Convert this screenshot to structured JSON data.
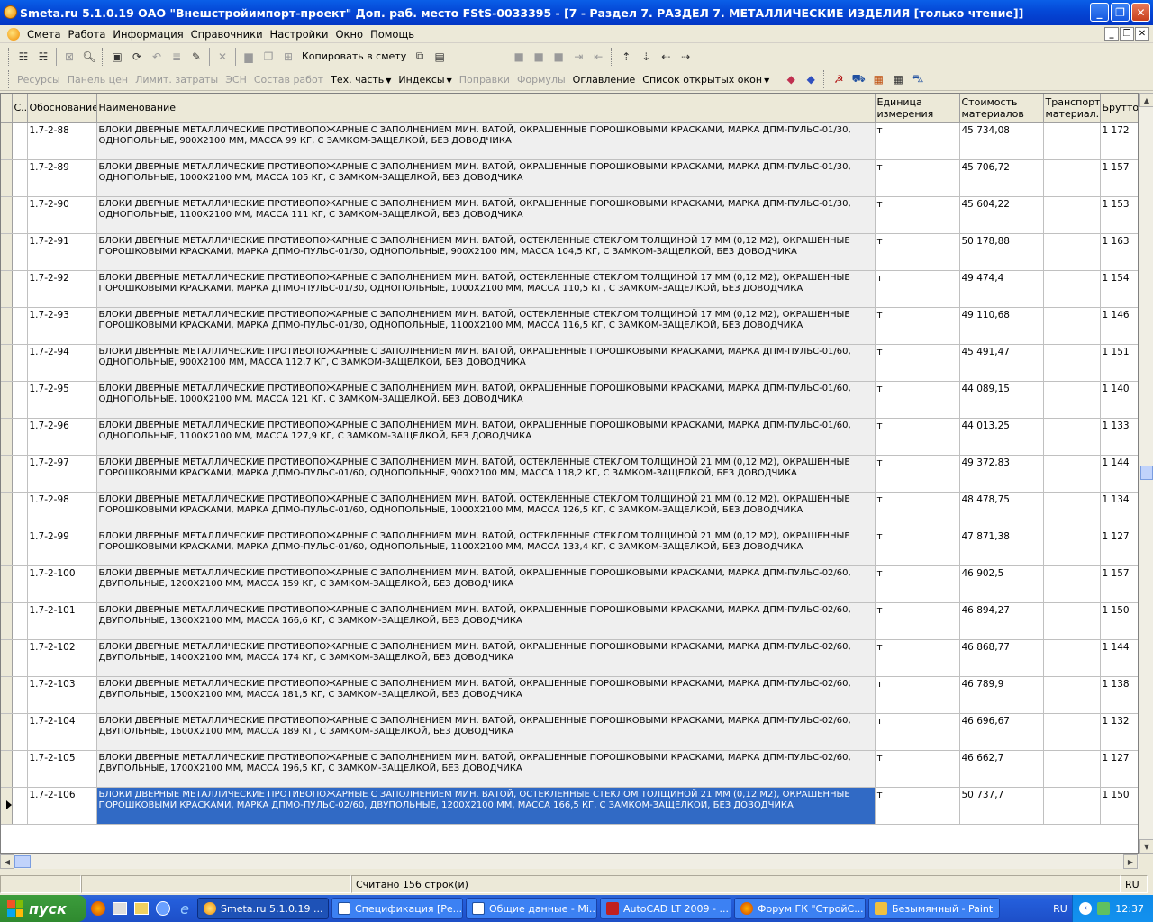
{
  "window": {
    "title": "Smeta.ru  5.1.0.19  ОАО \"Внешстройимпорт-проект\"  Доп. раб. место  FStS-0033395 - [7 - Раздел 7. РАЗДЕЛ 7. МЕТАЛЛИЧЕСКИЕ ИЗДЕЛИЯ   [только чтение]]"
  },
  "menu": [
    "Смета",
    "Работа",
    "Информация",
    "Справочники",
    "Настройки",
    "Окно",
    "Помощь"
  ],
  "toolbar1": {
    "copy_label": "Копировать в смету"
  },
  "toolbar2": {
    "resources": "Ресурсы",
    "price_panel": "Панель цен",
    "limit_costs": "Лимит. затраты",
    "esn": "ЭСН",
    "work_composition": "Состав работ",
    "tech_part": "Тех. часть",
    "indexes": "Индексы",
    "corrections": "Поправки",
    "formulas": "Формулы",
    "contents": "Оглавление",
    "open_windows": "Список открытых окон"
  },
  "columns": [
    "С...",
    "Обоснование",
    "Наименование",
    "Единица измерения",
    "Стоимость материалов",
    "Транспорт материал...",
    "Брутто"
  ],
  "rows": [
    {
      "code": "1.7-2-88",
      "name": "БЛОКИ ДВЕРНЫЕ МЕТАЛЛИЧЕСКИЕ ПРОТИВОПОЖАРНЫЕ С ЗАПОЛНЕНИЕМ МИН. ВАТОЙ, ОКРАШЕННЫЕ ПОРОШКОВЫМИ КРАСКАМИ, МАРКА ДПМ-ПУЛЬС-01/30, ОДНОПОЛЬНЫЕ, 900Х2100 ММ, МАССА 99 КГ, С ЗАМКОМ-ЗАЩЕЛКОЙ, БЕЗ ДОВОДЧИКА",
      "unit": "т",
      "cost": "45 734,08",
      "transport": "",
      "brutto": "1 172"
    },
    {
      "code": "1.7-2-89",
      "name": "БЛОКИ ДВЕРНЫЕ МЕТАЛЛИЧЕСКИЕ ПРОТИВОПОЖАРНЫЕ С ЗАПОЛНЕНИЕМ МИН. ВАТОЙ, ОКРАШЕННЫЕ ПОРОШКОВЫМИ КРАСКАМИ, МАРКА ДПМ-ПУЛЬС-01/30, ОДНОПОЛЬНЫЕ, 1000Х2100 ММ, МАССА 105 КГ, С ЗАМКОМ-ЗАЩЕЛКОЙ, БЕЗ ДОВОДЧИКА",
      "unit": "т",
      "cost": "45 706,72",
      "transport": "",
      "brutto": "1 157"
    },
    {
      "code": "1.7-2-90",
      "name": "БЛОКИ ДВЕРНЫЕ МЕТАЛЛИЧЕСКИЕ ПРОТИВОПОЖАРНЫЕ С ЗАПОЛНЕНИЕМ МИН. ВАТОЙ, ОКРАШЕННЫЕ ПОРОШКОВЫМИ КРАСКАМИ, МАРКА ДПМ-ПУЛЬС-01/30, ОДНОПОЛЬНЫЕ, 1100Х2100 ММ, МАССА 111 КГ, С ЗАМКОМ-ЗАЩЕЛКОЙ, БЕЗ ДОВОДЧИКА",
      "unit": "т",
      "cost": "45 604,22",
      "transport": "",
      "brutto": "1 153"
    },
    {
      "code": "1.7-2-91",
      "name": "БЛОКИ ДВЕРНЫЕ МЕТАЛЛИЧЕСКИЕ ПРОТИВОПОЖАРНЫЕ С ЗАПОЛНЕНИЕМ МИН. ВАТОЙ, ОСТЕКЛЕННЫЕ СТЕКЛОМ ТОЛЩИНОЙ 17 ММ (0,12 М2), ОКРАШЕННЫЕ ПОРОШКОВЫМИ КРАСКАМИ, МАРКА ДПМО-ПУЛЬС-01/30, ОДНОПОЛЬНЫЕ, 900Х2100 ММ, МАССА 104,5 КГ, С ЗАМКОМ-ЗАЩЕЛКОЙ, БЕЗ ДОВОДЧИКА",
      "unit": "т",
      "cost": "50 178,88",
      "transport": "",
      "brutto": "1 163"
    },
    {
      "code": "1.7-2-92",
      "name": "БЛОКИ ДВЕРНЫЕ МЕТАЛЛИЧЕСКИЕ ПРОТИВОПОЖАРНЫЕ С ЗАПОЛНЕНИЕМ МИН. ВАТОЙ, ОСТЕКЛЕННЫЕ СТЕКЛОМ ТОЛЩИНОЙ 17 ММ (0,12 М2), ОКРАШЕННЫЕ ПОРОШКОВЫМИ КРАСКАМИ, МАРКА ДПМО-ПУЛЬС-01/30, ОДНОПОЛЬНЫЕ, 1000Х2100 ММ, МАССА 110,5 КГ, С ЗАМКОМ-ЗАЩЕЛКОЙ, БЕЗ ДОВОДЧИКА",
      "unit": "т",
      "cost": "49 474,4",
      "transport": "",
      "brutto": "1 154"
    },
    {
      "code": "1.7-2-93",
      "name": "БЛОКИ ДВЕРНЫЕ МЕТАЛЛИЧЕСКИЕ ПРОТИВОПОЖАРНЫЕ С ЗАПОЛНЕНИЕМ МИН. ВАТОЙ, ОСТЕКЛЕННЫЕ СТЕКЛОМ ТОЛЩИНОЙ 17 ММ (0,12 М2), ОКРАШЕННЫЕ ПОРОШКОВЫМИ КРАСКАМИ, МАРКА ДПМО-ПУЛЬС-01/30, ОДНОПОЛЬНЫЕ, 1100Х2100 ММ, МАССА 116,5 КГ, С ЗАМКОМ-ЗАЩЕЛКОЙ, БЕЗ ДОВОДЧИКА",
      "unit": "т",
      "cost": "49 110,68",
      "transport": "",
      "brutto": "1 146"
    },
    {
      "code": "1.7-2-94",
      "name": "БЛОКИ ДВЕРНЫЕ МЕТАЛЛИЧЕСКИЕ ПРОТИВОПОЖАРНЫЕ С ЗАПОЛНЕНИЕМ МИН. ВАТОЙ, ОКРАШЕННЫЕ ПОРОШКОВЫМИ КРАСКАМИ, МАРКА ДПМ-ПУЛЬС-01/60, ОДНОПОЛЬНЫЕ, 900Х2100 ММ, МАССА 112,7 КГ, С ЗАМКОМ-ЗАЩЕЛКОЙ, БЕЗ ДОВОДЧИКА",
      "unit": "т",
      "cost": "45 491,47",
      "transport": "",
      "brutto": "1 151"
    },
    {
      "code": "1.7-2-95",
      "name": "БЛОКИ ДВЕРНЫЕ МЕТАЛЛИЧЕСКИЕ ПРОТИВОПОЖАРНЫЕ С ЗАПОЛНЕНИЕМ МИН. ВАТОЙ, ОКРАШЕННЫЕ ПОРОШКОВЫМИ КРАСКАМИ, МАРКА ДПМ-ПУЛЬС-01/60, ОДНОПОЛЬНЫЕ, 1000Х2100 ММ, МАССА 121 КГ, С ЗАМКОМ-ЗАЩЕЛКОЙ, БЕЗ ДОВОДЧИКА",
      "unit": "т",
      "cost": "44 089,15",
      "transport": "",
      "brutto": "1 140"
    },
    {
      "code": "1.7-2-96",
      "name": "БЛОКИ ДВЕРНЫЕ МЕТАЛЛИЧЕСКИЕ ПРОТИВОПОЖАРНЫЕ С ЗАПОЛНЕНИЕМ МИН. ВАТОЙ, ОКРАШЕННЫЕ ПОРОШКОВЫМИ КРАСКАМИ, МАРКА ДПМ-ПУЛЬС-01/60, ОДНОПОЛЬНЫЕ, 1100Х2100 ММ, МАССА 127,9 КГ, С ЗАМКОМ-ЗАЩЕЛКОЙ, БЕЗ ДОВОДЧИКА",
      "unit": "т",
      "cost": "44 013,25",
      "transport": "",
      "brutto": "1 133"
    },
    {
      "code": "1.7-2-97",
      "name": "БЛОКИ ДВЕРНЫЕ МЕТАЛЛИЧЕСКИЕ ПРОТИВОПОЖАРНЫЕ С ЗАПОЛНЕНИЕМ МИН. ВАТОЙ, ОСТЕКЛЕННЫЕ СТЕКЛОМ ТОЛЩИНОЙ 21 ММ (0,12 М2), ОКРАШЕННЫЕ ПОРОШКОВЫМИ КРАСКАМИ, МАРКА ДПМО-ПУЛЬС-01/60, ОДНОПОЛЬНЫЕ, 900Х2100 ММ, МАССА 118,2 КГ, С ЗАМКОМ-ЗАЩЕЛКОЙ, БЕЗ ДОВОДЧИКА",
      "unit": "т",
      "cost": "49 372,83",
      "transport": "",
      "brutto": "1 144"
    },
    {
      "code": "1.7-2-98",
      "name": "БЛОКИ ДВЕРНЫЕ МЕТАЛЛИЧЕСКИЕ ПРОТИВОПОЖАРНЫЕ С ЗАПОЛНЕНИЕМ МИН. ВАТОЙ, ОСТЕКЛЕННЫЕ СТЕКЛОМ ТОЛЩИНОЙ 21 ММ (0,12 М2), ОКРАШЕННЫЕ ПОРОШКОВЫМИ КРАСКАМИ, МАРКА ДПМО-ПУЛЬС-01/60, ОДНОПОЛЬНЫЕ, 1000Х2100 ММ, МАССА 126,5 КГ, С ЗАМКОМ-ЗАЩЕЛКОЙ, БЕЗ ДОВОДЧИКА",
      "unit": "т",
      "cost": "48 478,75",
      "transport": "",
      "brutto": "1 134"
    },
    {
      "code": "1.7-2-99",
      "name": "БЛОКИ ДВЕРНЫЕ МЕТАЛЛИЧЕСКИЕ ПРОТИВОПОЖАРНЫЕ С ЗАПОЛНЕНИЕМ МИН. ВАТОЙ, ОСТЕКЛЕННЫЕ СТЕКЛОМ ТОЛЩИНОЙ 21 ММ (0,12 М2), ОКРАШЕННЫЕ ПОРОШКОВЫМИ КРАСКАМИ, МАРКА ДПМО-ПУЛЬС-01/60, ОДНОПОЛЬНЫЕ, 1100Х2100 ММ, МАССА 133,4 КГ, С ЗАМКОМ-ЗАЩЕЛКОЙ, БЕЗ ДОВОДЧИКА",
      "unit": "т",
      "cost": "47 871,38",
      "transport": "",
      "brutto": "1 127"
    },
    {
      "code": "1.7-2-100",
      "name": "БЛОКИ ДВЕРНЫЕ МЕТАЛЛИЧЕСКИЕ ПРОТИВОПОЖАРНЫЕ С ЗАПОЛНЕНИЕМ МИН. ВАТОЙ, ОКРАШЕННЫЕ ПОРОШКОВЫМИ КРАСКАМИ, МАРКА ДПМ-ПУЛЬС-02/60, ДВУПОЛЬНЫЕ, 1200Х2100 ММ, МАССА 159 КГ, С ЗАМКОМ-ЗАЩЕЛКОЙ, БЕЗ ДОВОДЧИКА",
      "unit": "т",
      "cost": "46 902,5",
      "transport": "",
      "brutto": "1 157"
    },
    {
      "code": "1.7-2-101",
      "name": "БЛОКИ ДВЕРНЫЕ МЕТАЛЛИЧЕСКИЕ ПРОТИВОПОЖАРНЫЕ С ЗАПОЛНЕНИЕМ МИН. ВАТОЙ, ОКРАШЕННЫЕ ПОРОШКОВЫМИ КРАСКАМИ, МАРКА ДПМ-ПУЛЬС-02/60, ДВУПОЛЬНЫЕ, 1300Х2100 ММ, МАССА 166,6 КГ, С ЗАМКОМ-ЗАЩЕЛКОЙ, БЕЗ ДОВОДЧИКА",
      "unit": "т",
      "cost": "46 894,27",
      "transport": "",
      "brutto": "1 150"
    },
    {
      "code": "1.7-2-102",
      "name": "БЛОКИ ДВЕРНЫЕ МЕТАЛЛИЧЕСКИЕ ПРОТИВОПОЖАРНЫЕ С ЗАПОЛНЕНИЕМ МИН. ВАТОЙ, ОКРАШЕННЫЕ ПОРОШКОВЫМИ КРАСКАМИ, МАРКА ДПМ-ПУЛЬС-02/60, ДВУПОЛЬНЫЕ, 1400Х2100 ММ, МАССА 174 КГ, С ЗАМКОМ-ЗАЩЕЛКОЙ, БЕЗ ДОВОДЧИКА",
      "unit": "т",
      "cost": "46 868,77",
      "transport": "",
      "brutto": "1 144"
    },
    {
      "code": "1.7-2-103",
      "name": "БЛОКИ ДВЕРНЫЕ МЕТАЛЛИЧЕСКИЕ ПРОТИВОПОЖАРНЫЕ С ЗАПОЛНЕНИЕМ МИН. ВАТОЙ, ОКРАШЕННЫЕ ПОРОШКОВЫМИ КРАСКАМИ, МАРКА ДПМ-ПУЛЬС-02/60, ДВУПОЛЬНЫЕ, 1500Х2100 ММ, МАССА 181,5 КГ, С ЗАМКОМ-ЗАЩЕЛКОЙ, БЕЗ ДОВОДЧИКА",
      "unit": "т",
      "cost": "46 789,9",
      "transport": "",
      "brutto": "1 138"
    },
    {
      "code": "1.7-2-104",
      "name": "БЛОКИ ДВЕРНЫЕ МЕТАЛЛИЧЕСКИЕ ПРОТИВОПОЖАРНЫЕ С ЗАПОЛНЕНИЕМ МИН. ВАТОЙ, ОКРАШЕННЫЕ ПОРОШКОВЫМИ КРАСКАМИ, МАРКА ДПМ-ПУЛЬС-02/60, ДВУПОЛЬНЫЕ, 1600Х2100 ММ, МАССА 189 КГ, С ЗАМКОМ-ЗАЩЕЛКОЙ, БЕЗ ДОВОДЧИКА",
      "unit": "т",
      "cost": "46 696,67",
      "transport": "",
      "brutto": "1 132"
    },
    {
      "code": "1.7-2-105",
      "name": "БЛОКИ ДВЕРНЫЕ МЕТАЛЛИЧЕСКИЕ ПРОТИВОПОЖАРНЫЕ С ЗАПОЛНЕНИЕМ МИН. ВАТОЙ, ОКРАШЕННЫЕ ПОРОШКОВЫМИ КРАСКАМИ, МАРКА ДПМ-ПУЛЬС-02/60, ДВУПОЛЬНЫЕ, 1700Х2100 ММ, МАССА 196,5 КГ, С ЗАМКОМ-ЗАЩЕЛКОЙ, БЕЗ ДОВОДЧИКА",
      "unit": "т",
      "cost": "46 662,7",
      "transport": "",
      "brutto": "1 127"
    },
    {
      "code": "1.7-2-106",
      "name": "БЛОКИ ДВЕРНЫЕ МЕТАЛЛИЧЕСКИЕ ПРОТИВОПОЖАРНЫЕ С ЗАПОЛНЕНИЕМ МИН. ВАТОЙ, ОСТЕКЛЕННЫЕ СТЕКЛОМ ТОЛЩИНОЙ 21 ММ (0,12 М2), ОКРАШЕННЫЕ ПОРОШКОВЫМИ КРАСКАМИ, МАРКА ДПМО-ПУЛЬС-02/60, ДВУПОЛЬНЫЕ, 1200Х2100 ММ, МАССА 166,5 КГ, С ЗАМКОМ-ЗАЩЕЛКОЙ, БЕЗ ДОВОДЧИКА",
      "unit": "т",
      "cost": "50 737,7",
      "transport": "",
      "brutto": "1 150",
      "selected": true
    }
  ],
  "status": {
    "rows_counted": "Считано 156 строк(и)",
    "lang": "RU"
  },
  "taskbar": {
    "start": "пуск",
    "buttons": [
      "Smeta.ru  5.1.0.19 ...",
      "Спецификация [Ре...",
      "Общие данные - Mi...",
      "AutoCAD LT 2009 - ...",
      "Форум ГК \"СтройС...",
      "Безымянный - Paint"
    ],
    "lang": "RU",
    "clock": "12:37"
  },
  "colors": {
    "selection": "#316ac5",
    "titlebar": "#0447d6",
    "taskbar": "#245edb",
    "start": "#3c9c3c"
  }
}
